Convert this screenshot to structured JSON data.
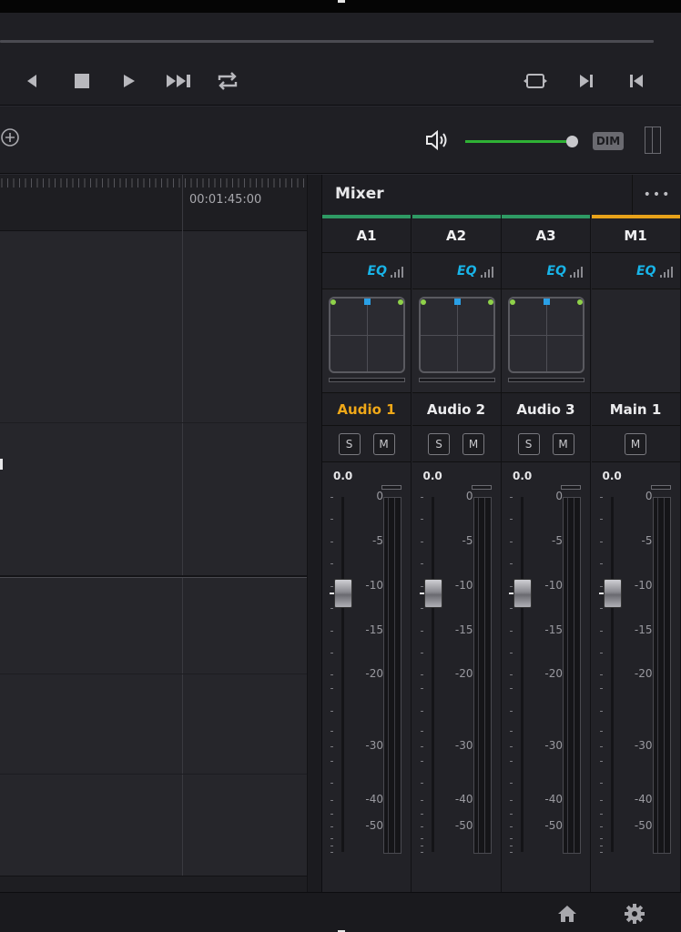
{
  "transport": {
    "buttons": [
      {
        "name": "previous-frame-button",
        "icon": "play-reverse-icon"
      },
      {
        "name": "stop-button",
        "icon": "stop-icon"
      },
      {
        "name": "play-button",
        "icon": "play-icon"
      },
      {
        "name": "fast-forward-button",
        "icon": "fast-forward-icon"
      },
      {
        "name": "loop-button",
        "icon": "loop-icon"
      }
    ],
    "right_buttons": [
      {
        "name": "fit-button",
        "icon": "fit-icon"
      },
      {
        "name": "next-clip-button",
        "icon": "skip-forward-icon"
      },
      {
        "name": "prev-clip-button",
        "icon": "skip-back-icon"
      }
    ]
  },
  "volume": {
    "level": 0.9,
    "dim_label": "DIM",
    "accent_color": "#2fb135"
  },
  "timeline": {
    "timecode": "00:01:45:00"
  },
  "mixer": {
    "title": "Mixer",
    "options_label": "•••",
    "strips": [
      {
        "id": "A1",
        "eq": "EQ",
        "name": "Audio 1",
        "name_color": "#f0a818",
        "color": "#2e9a64",
        "solo": "S",
        "mute": "M",
        "gain": "0.0",
        "fader_db": -10,
        "has_pan": true,
        "has_solo": true
      },
      {
        "id": "A2",
        "eq": "EQ",
        "name": "Audio 2",
        "name_color": "#ececee",
        "color": "#2e9a64",
        "solo": "S",
        "mute": "M",
        "gain": "0.0",
        "fader_db": -10,
        "has_pan": true,
        "has_solo": true
      },
      {
        "id": "A3",
        "eq": "EQ",
        "name": "Audio 3",
        "name_color": "#ececee",
        "color": "#2e9a64",
        "solo": "S",
        "mute": "M",
        "gain": "0.0",
        "fader_db": -10,
        "has_pan": true,
        "has_solo": true
      },
      {
        "id": "M1",
        "eq": "EQ",
        "name": "Main 1",
        "name_color": "#ececee",
        "color": "#e8a21a",
        "solo": "",
        "mute": "M",
        "gain": "0.0",
        "fader_db": -10,
        "has_pan": false,
        "has_solo": false
      }
    ],
    "scale": [
      "0",
      "-5",
      "-10",
      "-15",
      "-20",
      "-30",
      "-40",
      "-50"
    ]
  },
  "footer": {
    "home_icon": "home-icon",
    "settings_icon": "gear-icon"
  }
}
